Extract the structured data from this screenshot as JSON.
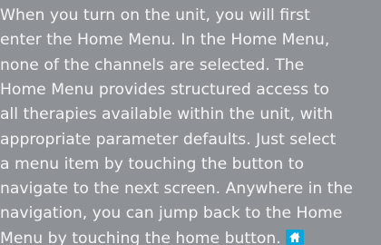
{
  "paragraph": {
    "lines": [
      "When you turn on the unit, you will first",
      "enter the Home Menu. In the Home Menu,",
      "none of the channels are selected. The",
      "Home Menu provides structured access to",
      "all therapies available within the unit, with",
      "appropriate parameter defaults. Just select",
      "a menu item by touching the button to",
      "navigate to the next screen. Anywhere in the",
      "navigation, you can jump back to the Home",
      "Menu by touching the home button."
    ]
  },
  "icons": {
    "home_button": "home-icon"
  },
  "colors": {
    "background": "#8e9195",
    "text": "#f4f5f6",
    "home_button": "#0aa6dc"
  }
}
